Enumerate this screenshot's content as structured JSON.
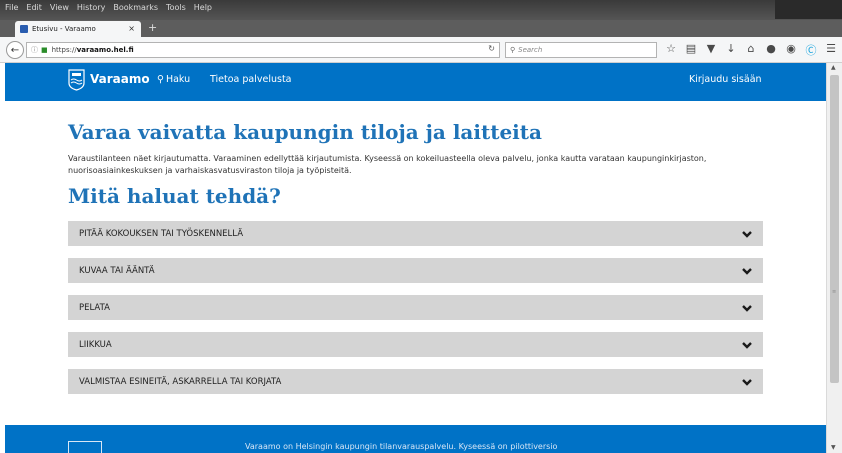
{
  "browser": {
    "menu": [
      "File",
      "Edit",
      "View",
      "History",
      "Bookmarks",
      "Tools",
      "Help"
    ],
    "tab": {
      "title": "Etusivu - Varaamo",
      "close": "×"
    },
    "new_tab": "+",
    "url": {
      "scheme": "https://",
      "host": "varaamo.hel.fi"
    },
    "search_placeholder": "Search",
    "icons": [
      "bookmark-star-icon",
      "reading-list-icon",
      "pocket-icon",
      "download-icon",
      "home-icon",
      "hello-icon",
      "notifications-icon",
      "skype-icon",
      "menu-icon"
    ]
  },
  "header": {
    "brand": "Varaamo",
    "nav": {
      "search": "Haku",
      "about": "Tietoa palvelusta"
    },
    "login": "Kirjaudu sisään"
  },
  "main": {
    "title": "Varaa vaivatta kaupungin tiloja ja laitteita",
    "intro": "Varaustilanteen näet kirjautumatta. Varaaminen edellyttää kirjautumista. Kyseessä on kokeiluasteella oleva palvelu, jonka kautta varataan kaupunginkirjaston, nuorisoasiainkeskuksen ja varhaiskasvatusviraston tiloja ja työpisteitä.",
    "question": "Mitä haluat tehdä?",
    "categories": [
      "PITÄÄ KOKOUKSEN TAI TYÖSKENNELLÄ",
      "KUVAA TAI ÄÄNTÄ",
      "PELATA",
      "LIIKKUA",
      "VALMISTAA ESINEITÄ, ASKARRELLA TAI KORJATA"
    ]
  },
  "footer": {
    "text": "Varaamo on Helsingin kaupungin tilanvarauspalvelu. Kyseessä on pilottiversio"
  },
  "colors": {
    "brand_blue": "#0072c6",
    "title_blue": "#1f73b7",
    "accordion_gray": "#d4d4d4"
  }
}
